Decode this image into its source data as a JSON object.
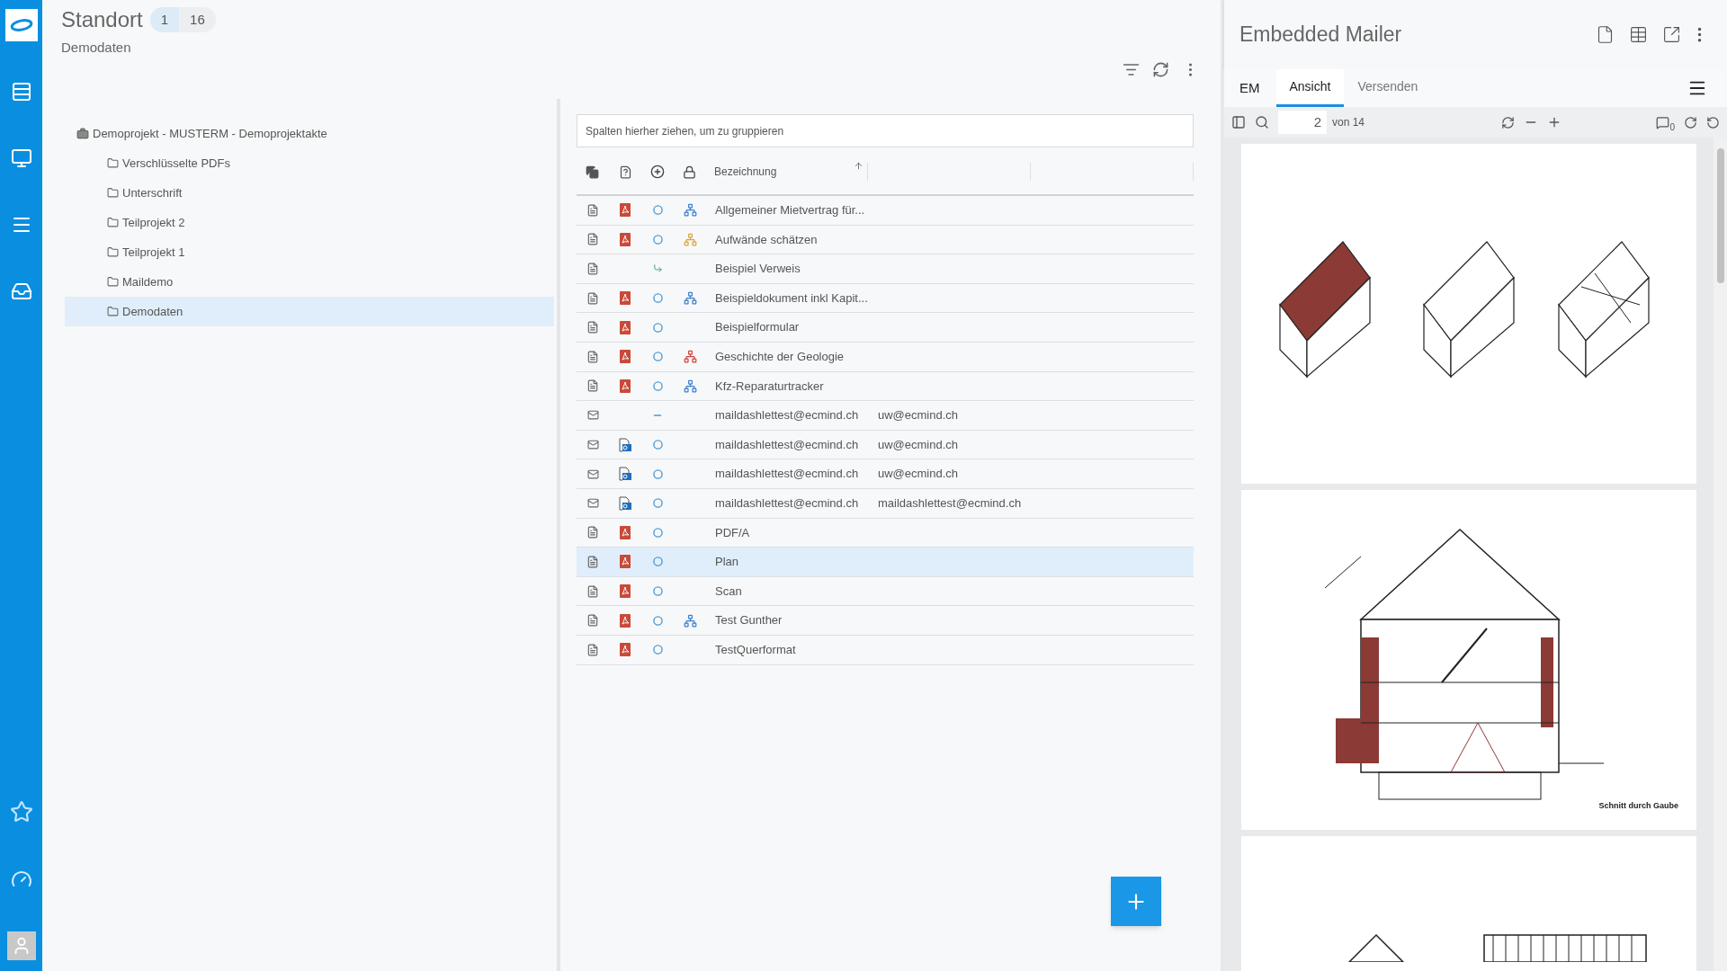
{
  "header": {
    "title": "Standort",
    "subtitle": "Demodaten",
    "badges": [
      {
        "label": "1",
        "selected": true
      },
      {
        "label": "16",
        "selected": false
      }
    ]
  },
  "tree": {
    "label": "Demoprojekt - MUSTERM - Demoprojektakte",
    "children": [
      {
        "label": "Verschlüsselte PDFs",
        "selected": false
      },
      {
        "label": "Unterschrift",
        "selected": false
      },
      {
        "label": "Teilprojekt 2",
        "selected": false
      },
      {
        "label": "Teilprojekt 1",
        "selected": false
      },
      {
        "label": "Maildemo",
        "selected": false
      },
      {
        "label": "Demodaten",
        "selected": true
      }
    ]
  },
  "table": {
    "group_placeholder": "Spalten hierher ziehen, um zu gruppieren",
    "columns": [
      "Bezeichnung"
    ],
    "rows": [
      {
        "kind": "document",
        "icons": [
          {
            "kind": "pdf"
          },
          {
            "kind": "circle"
          },
          {
            "kind": "workflow",
            "color": "#3b7fd0"
          }
        ],
        "cells": [
          "Allgemeiner Mietvertrag für..."
        ],
        "selected": false
      },
      {
        "kind": "document",
        "icons": [
          {
            "kind": "pdf"
          },
          {
            "kind": "circle"
          },
          {
            "kind": "workflow",
            "color": "#d9a441"
          }
        ],
        "cells": [
          "Aufwände schätzen"
        ],
        "selected": false
      },
      {
        "kind": "document",
        "icons": [
          {
            "kind": "link"
          }
        ],
        "cells": [
          "Beispiel Verweis"
        ],
        "selected": false
      },
      {
        "kind": "document",
        "icons": [
          {
            "kind": "pdf"
          },
          {
            "kind": "circle"
          },
          {
            "kind": "workflow",
            "color": "#3b7fd0"
          }
        ],
        "cells": [
          "Beispieldokument inkl Kapit..."
        ],
        "selected": false
      },
      {
        "kind": "document",
        "icons": [
          {
            "kind": "pdf"
          },
          {
            "kind": "circle"
          }
        ],
        "cells": [
          "Beispielformular"
        ],
        "selected": false
      },
      {
        "kind": "document",
        "icons": [
          {
            "kind": "pdf"
          },
          {
            "kind": "circle"
          },
          {
            "kind": "workflow",
            "color": "#d0433b"
          }
        ],
        "cells": [
          "Geschichte der Geologie"
        ],
        "selected": false
      },
      {
        "kind": "document",
        "icons": [
          {
            "kind": "pdf"
          },
          {
            "kind": "circle"
          },
          {
            "kind": "workflow",
            "color": "#3b7fd0"
          }
        ],
        "cells": [
          "Kfz-Reparaturtracker"
        ],
        "selected": false
      },
      {
        "kind": "mail",
        "icons": [
          {
            "kind": "dash"
          }
        ],
        "cells": [
          "maildashlettest@ecmind.ch",
          "uw@ecmind.ch"
        ],
        "selected": false
      },
      {
        "kind": "mail",
        "icons": [
          {
            "kind": "outlook"
          },
          {
            "kind": "circle"
          }
        ],
        "cells": [
          "maildashlettest@ecmind.ch",
          "uw@ecmind.ch"
        ],
        "selected": false
      },
      {
        "kind": "mail",
        "icons": [
          {
            "kind": "outlook"
          },
          {
            "kind": "circle"
          }
        ],
        "cells": [
          "maildashlettest@ecmind.ch",
          "uw@ecmind.ch"
        ],
        "selected": false
      },
      {
        "kind": "mail",
        "icons": [
          {
            "kind": "outlook"
          },
          {
            "kind": "circle"
          }
        ],
        "cells": [
          "maildashlettest@ecmind.ch",
          "maildashlettest@ecmind.ch"
        ],
        "selected": false
      },
      {
        "kind": "document",
        "icons": [
          {
            "kind": "pdf"
          },
          {
            "kind": "circle"
          }
        ],
        "cells": [
          "PDF/A"
        ],
        "selected": false
      },
      {
        "kind": "document",
        "icons": [
          {
            "kind": "pdf"
          },
          {
            "kind": "circle"
          }
        ],
        "cells": [
          "Plan"
        ],
        "selected": true
      },
      {
        "kind": "document",
        "icons": [
          {
            "kind": "pdf"
          },
          {
            "kind": "circle"
          }
        ],
        "cells": [
          "Scan"
        ],
        "selected": false
      },
      {
        "kind": "document",
        "icons": [
          {
            "kind": "pdf"
          },
          {
            "kind": "circle"
          },
          {
            "kind": "workflow",
            "color": "#3b7fd0"
          }
        ],
        "cells": [
          "Test Gunther"
        ],
        "selected": false
      },
      {
        "kind": "document",
        "icons": [
          {
            "kind": "pdf"
          },
          {
            "kind": "circle"
          }
        ],
        "cells": [
          "TestQuerformat"
        ],
        "selected": false
      }
    ]
  },
  "viewer": {
    "title": "Embedded Mailer",
    "prefix": "EM",
    "tabs": [
      {
        "label": "Ansicht",
        "selected": true
      },
      {
        "label": "Versenden",
        "selected": false
      }
    ],
    "page": "2",
    "page_count": "von 14",
    "comments": "0",
    "pages": [
      {
        "kind": "roofs"
      },
      {
        "kind": "section",
        "caption": "Schnitt durch Gaube"
      },
      {
        "kind": "frames"
      }
    ]
  }
}
